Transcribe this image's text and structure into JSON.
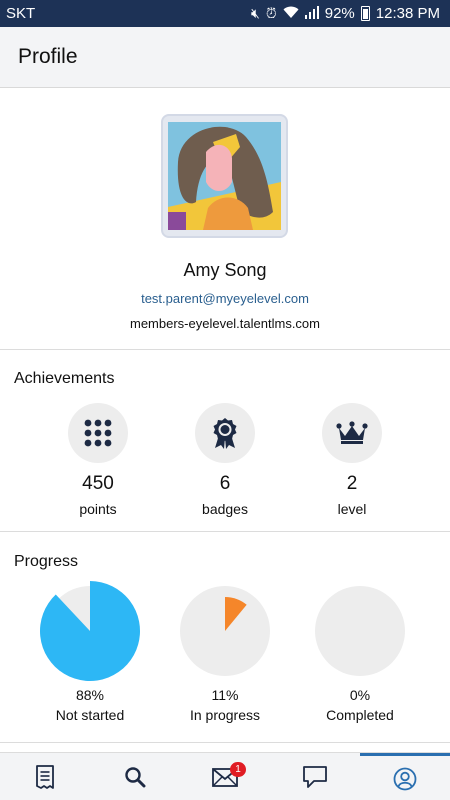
{
  "status_bar": {
    "carrier": "SKT",
    "battery": "92%",
    "time": "12:38 PM"
  },
  "app_bar": {
    "title": "Profile"
  },
  "profile": {
    "name": "Amy Song",
    "email": "test.parent@myeyelevel.com",
    "domain": "members-eyelevel.talentlms.com"
  },
  "achievements": {
    "title": "Achievements",
    "items": [
      {
        "icon": "grid-dots-icon",
        "value": "450",
        "label": "points"
      },
      {
        "icon": "award-badge-icon",
        "value": "6",
        "label": "badges"
      },
      {
        "icon": "crown-icon",
        "value": "2",
        "label": "level"
      }
    ]
  },
  "progress": {
    "title": "Progress",
    "items": [
      {
        "percent": "88%",
        "fraction": 0.88,
        "label": "Not started",
        "color": "#2db7f5"
      },
      {
        "percent": "11%",
        "fraction": 0.11,
        "label": "In progress",
        "color": "#f5862a"
      },
      {
        "percent": "0%",
        "fraction": 0.0,
        "label": "Completed",
        "color": "#9bd84a"
      }
    ],
    "track_color": "#ededed"
  },
  "bottom_nav": {
    "items": [
      {
        "icon": "catalog-icon",
        "active": false
      },
      {
        "icon": "search-icon",
        "active": false
      },
      {
        "icon": "mail-icon",
        "active": false,
        "badge": "1"
      },
      {
        "icon": "chat-icon",
        "active": false
      },
      {
        "icon": "profile-icon",
        "active": true
      }
    ]
  },
  "colors": {
    "status_bar": "#1d3256",
    "link": "#2a5f8f",
    "active_tab": "#2a6fb0",
    "icon_dark": "#1d2a44"
  }
}
